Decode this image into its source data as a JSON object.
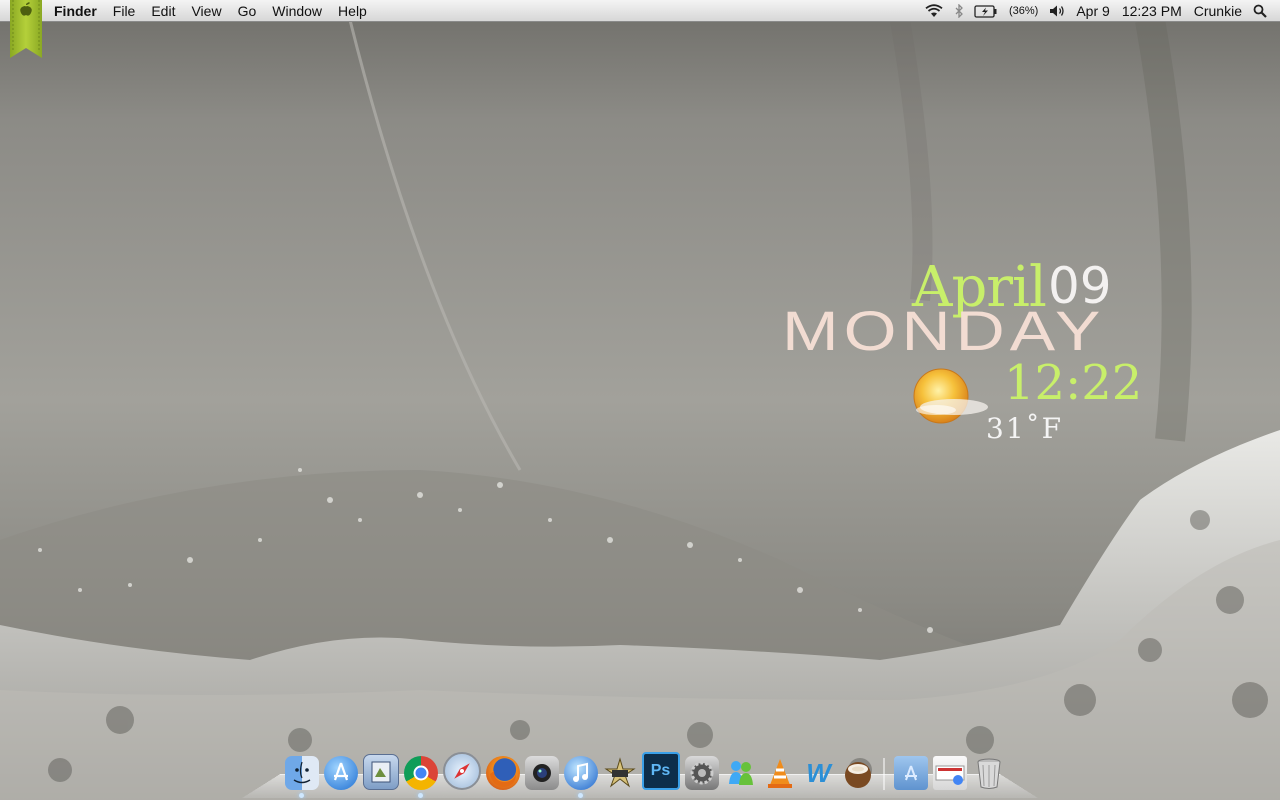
{
  "menubar": {
    "apple_menu_icon": "apple-icon",
    "app_name": "Finder",
    "items": [
      "File",
      "Edit",
      "View",
      "Go",
      "Window",
      "Help"
    ],
    "status": {
      "wifi_icon": "wifi-icon",
      "bluetooth_icon": "bluetooth-icon",
      "battery_icon": "battery-charging-icon",
      "battery_percent": "(36%)",
      "volume_icon": "volume-icon",
      "date": "Apr 9",
      "time": "12:23 PM",
      "user": "Crunkie",
      "spotlight_icon": "spotlight-search-icon"
    }
  },
  "widget": {
    "month": "April",
    "day": "09",
    "weekday": "MONDAY",
    "time": "12:22",
    "temperature": "31˚F",
    "weather_icon": "sunny-icon"
  },
  "dock": {
    "apps": [
      {
        "name": "finder-icon"
      },
      {
        "name": "app-store-icon"
      },
      {
        "name": "preview-icon"
      },
      {
        "name": "chrome-icon"
      },
      {
        "name": "safari-icon"
      },
      {
        "name": "firefox-icon"
      },
      {
        "name": "facetime-camera-icon"
      },
      {
        "name": "itunes-icon"
      },
      {
        "name": "imovie-icon"
      },
      {
        "name": "photoshop-icon"
      },
      {
        "name": "system-preferences-icon"
      },
      {
        "name": "messenger-icon"
      },
      {
        "name": "vlc-icon"
      },
      {
        "name": "word-icon"
      },
      {
        "name": "coconut-battery-icon"
      }
    ],
    "stacks": [
      {
        "name": "applications-folder-icon"
      },
      {
        "name": "downloads-stack-icon"
      },
      {
        "name": "trash-icon"
      }
    ]
  }
}
